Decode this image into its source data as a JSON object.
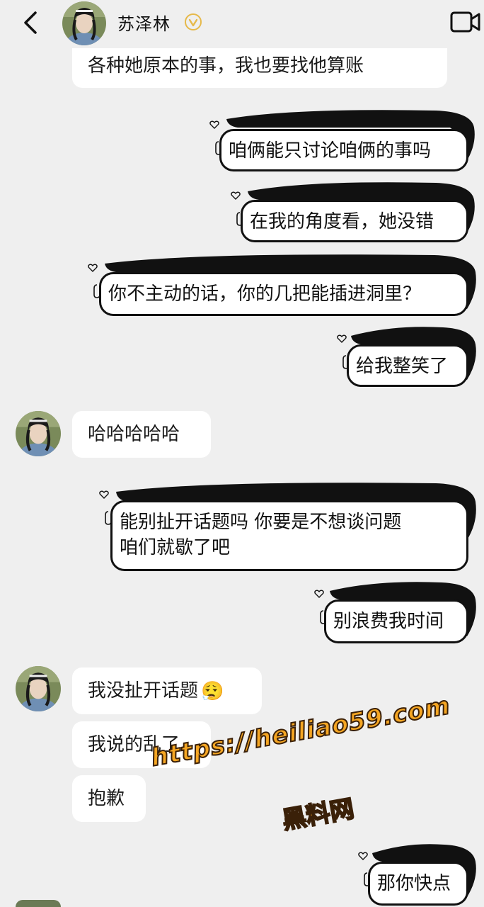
{
  "header": {
    "contact_name": "苏泽林",
    "back_icon": "chevron-left-icon",
    "verified_icon": "verified-badge-icon",
    "video_icon": "video-call-icon"
  },
  "messages": [
    {
      "id": "m1",
      "side": "received",
      "text": "各种她原本的事，我也要找他算账"
    },
    {
      "id": "m2",
      "side": "sent",
      "lines": [
        "咱俩能只讨论咱俩的事吗"
      ]
    },
    {
      "id": "m3",
      "side": "sent",
      "lines": [
        "在我的角度看，她没错"
      ]
    },
    {
      "id": "m4",
      "side": "sent",
      "lines": [
        "你不主动的话，你的几把能插进洞里？"
      ]
    },
    {
      "id": "m5",
      "side": "sent",
      "lines": [
        "给我整笑了"
      ]
    },
    {
      "id": "m6",
      "side": "received",
      "text": "哈哈哈哈哈"
    },
    {
      "id": "m7",
      "side": "sent",
      "lines": [
        "能别扯开话题吗  你要是不想谈问题",
        "咱们就歇了吧"
      ]
    },
    {
      "id": "m8",
      "side": "sent",
      "lines": [
        "别浪费我时间"
      ]
    },
    {
      "id": "m9",
      "side": "received",
      "text": "我没扯开话题",
      "emoji": "😮‍💨"
    },
    {
      "id": "m10",
      "side": "received",
      "text": "我说的乱了"
    },
    {
      "id": "m11",
      "side": "received",
      "text": "抱歉"
    },
    {
      "id": "m12",
      "side": "sent",
      "lines": [
        "那你快点"
      ]
    }
  ],
  "watermark": {
    "url": "https://heiliao59.com",
    "name": "黑料网"
  },
  "colors": {
    "background": "#efefef",
    "bubble_in": "#ffffff",
    "bubble_border": "#111111",
    "watermark": "#f5a623",
    "verified": "#e6b94a"
  }
}
